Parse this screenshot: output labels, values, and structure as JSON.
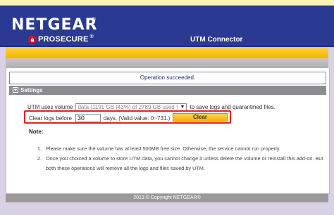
{
  "header": {
    "brand": "NETGEAR",
    "brand_mark": "®",
    "sub_brand": "PROSECURE",
    "sub_brand_mark": "®",
    "product_title": "UTM Connector",
    "icon": "lock-badge-icon"
  },
  "status": {
    "message": "Operation succeeded."
  },
  "settings": {
    "section_title": "Settings",
    "volume_label": "UTM uses volume",
    "volume_value": "data (1191 GB (43%) of 2789 GB used )",
    "volume_suffix": "to save logs and quarantined files.",
    "clear_label": "Clear logs before",
    "days_value": "30",
    "days_hint": "days. (Valid value: 0~731.)",
    "clear_button": "Clear"
  },
  "note": {
    "title": "Note:",
    "items": [
      {
        "num": "1.",
        "text": "Please make sure the volume has at least 500MB free size. Otherwise, the service cannot run properly."
      },
      {
        "num": "2.",
        "text": "Once you choiced a volume to store UTM data, you cannot change it unless delete the volume or reinstall this add-on. But both these operations will remove all the logs and files saved by UTM."
      }
    ]
  },
  "footer": {
    "copyright": "2013 © Copyright NETGEAR®"
  },
  "colors": {
    "header_bg": "#2a3a92",
    "accent_orange": "#f6b400",
    "highlight_red": "#e02222"
  }
}
